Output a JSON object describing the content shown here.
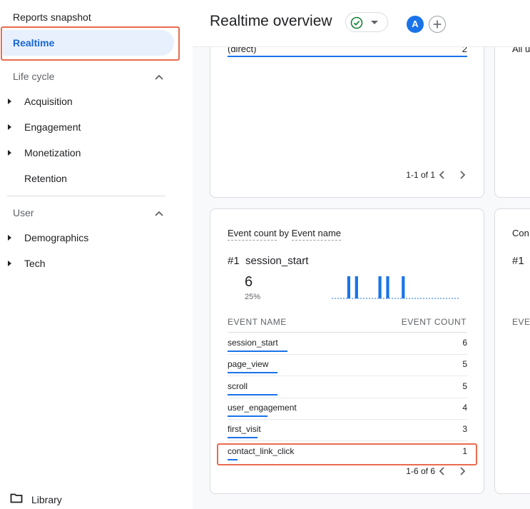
{
  "sidebar": {
    "title": "Reports snapshot",
    "realtime_label": "Realtime",
    "lifecycle_label": "Life cycle",
    "lifecycle_items": [
      {
        "label": "Acquisition"
      },
      {
        "label": "Engagement"
      },
      {
        "label": "Monetization"
      },
      {
        "label": "Retention"
      }
    ],
    "user_label": "User",
    "user_items": [
      {
        "label": "Demographics"
      },
      {
        "label": "Tech"
      }
    ],
    "library_label": "Library"
  },
  "header": {
    "title": "Realtime overview",
    "avatar_letter": "A"
  },
  "card1": {
    "row_label": "(direct)",
    "row_value": "2",
    "pagination": "1-1 of 1"
  },
  "card1b": {
    "row_label": "All u"
  },
  "card2": {
    "title_part1": "Event count",
    "title_by": "by",
    "title_part2": "Event name",
    "rank": "#1",
    "top_event": "session_start",
    "top_value": "6",
    "top_percent": "25%",
    "col_name": "EVENT NAME",
    "col_count": "EVENT COUNT",
    "rows": [
      {
        "name": "session_start",
        "count": "6",
        "share": 1.0
      },
      {
        "name": "page_view",
        "count": "5",
        "share": 0.83
      },
      {
        "name": "scroll",
        "count": "5",
        "share": 0.83
      },
      {
        "name": "user_engagement",
        "count": "4",
        "share": 0.67
      },
      {
        "name": "first_visit",
        "count": "3",
        "share": 0.5
      },
      {
        "name": "contact_link_click",
        "count": "1",
        "share": 0.17
      }
    ],
    "pagination": "1-6 of 6",
    "sparkline": [
      0,
      0,
      0,
      0,
      1,
      0,
      1,
      0,
      0,
      0,
      0,
      0,
      1,
      0,
      1,
      0,
      0,
      0,
      1,
      0,
      0,
      0,
      0,
      0,
      0,
      0,
      0,
      0,
      0,
      0,
      0,
      0,
      0
    ]
  },
  "card2b": {
    "title": "Con",
    "rank": "#1",
    "col": "EVE"
  },
  "colors": {
    "accent": "#1a73e8",
    "highlight": "#ea6b4f",
    "selected_bg": "#e8f0fe",
    "check": "#188038"
  }
}
